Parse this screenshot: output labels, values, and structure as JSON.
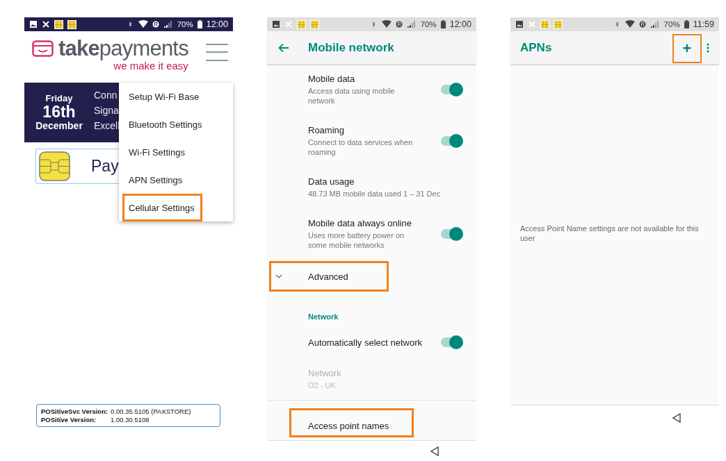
{
  "screens": [
    {
      "kind": "launcher",
      "status_bar": {
        "dark": true,
        "battery": "70%",
        "time": "12:00"
      },
      "logo": {
        "name": "**take**payments",
        "tagline": "we make it easy"
      },
      "date": {
        "day": "Friday",
        "date": "16th",
        "month": "December"
      },
      "status_lines": [
        "Conn",
        "Signa",
        "Excell"
      ],
      "pay_card": {
        "label": "Pay"
      },
      "menu": [
        {
          "label": "Setup Wi-Fi Base",
          "highlighted": false
        },
        {
          "label": "Bluetooth Settings",
          "highlighted": false
        },
        {
          "label": "Wi-Fi Settings",
          "highlighted": false
        },
        {
          "label": "APN Settings",
          "highlighted": false
        },
        {
          "label": "Cellular Settings",
          "highlighted": true
        }
      ],
      "versions": [
        {
          "label": "POSitiveSvc Version:",
          "value": "0.00.35.5105 (PAXSTORE)"
        },
        {
          "label": "POSitive Version:",
          "value": "1.00.30.5108"
        }
      ]
    },
    {
      "kind": "settings",
      "status_bar": {
        "dark": false,
        "battery": "70%",
        "time": "12:00"
      },
      "title": "Mobile network",
      "rows": [
        {
          "kind": "toggle",
          "title": "Mobile data",
          "summary": "Access data using mobile network",
          "on": true,
          "highlighted": false
        },
        {
          "kind": "toggle",
          "title": "Roaming",
          "summary": "Connect to data services when roaming",
          "on": true,
          "highlighted": false
        },
        {
          "kind": "info",
          "title": "Data usage",
          "summary": "48.73 MB mobile data used 1 – 31 Dec",
          "disabled": false
        },
        {
          "kind": "toggle",
          "title": "Mobile data always online",
          "summary": "Uses more battery power on some mobile networks",
          "on": true,
          "highlighted": false
        },
        {
          "kind": "expander",
          "title": "Advanced",
          "highlighted": true
        },
        {
          "kind": "category",
          "title": "Network"
        },
        {
          "kind": "toggle",
          "title": "Automatically select network",
          "on": true,
          "highlighted": false
        },
        {
          "kind": "info",
          "title": "Network",
          "summary": "O2 - UK",
          "disabled": true
        },
        {
          "kind": "link",
          "title": "Access point names",
          "highlighted": true
        }
      ]
    },
    {
      "kind": "apns",
      "status_bar": {
        "dark": false,
        "battery": "70%",
        "time": "11:59"
      },
      "title": "APNs",
      "add_button": {
        "label": "+",
        "highlighted": true
      },
      "message": "Access Point Name settings are not available for this user"
    }
  ]
}
